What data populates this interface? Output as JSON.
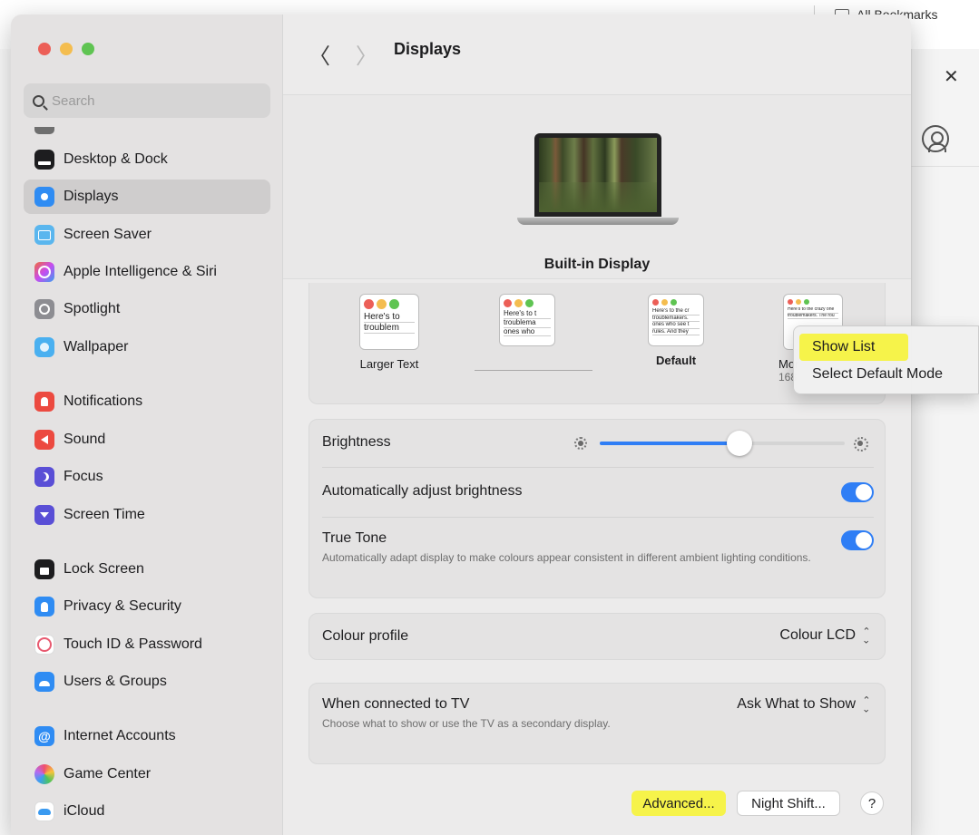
{
  "browser": {
    "bookmarks_label": "All Bookmarks",
    "close_glyph": "✕"
  },
  "sidebar": {
    "search_placeholder": "Search",
    "items": [
      {
        "label": "Desktop & Dock",
        "icon": "dock-icon"
      },
      {
        "label": "Displays",
        "icon": "displays-icon",
        "selected": true
      },
      {
        "label": "Screen Saver",
        "icon": "screen-saver-icon"
      },
      {
        "label": "Apple Intelligence & Siri",
        "icon": "siri-icon"
      },
      {
        "label": "Spotlight",
        "icon": "spotlight-icon"
      },
      {
        "label": "Wallpaper",
        "icon": "wallpaper-icon"
      },
      {
        "label": "Notifications",
        "icon": "notifications-icon"
      },
      {
        "label": "Sound",
        "icon": "sound-icon"
      },
      {
        "label": "Focus",
        "icon": "focus-icon"
      },
      {
        "label": "Screen Time",
        "icon": "screen-time-icon"
      },
      {
        "label": "Lock Screen",
        "icon": "lock-screen-icon"
      },
      {
        "label": "Privacy & Security",
        "icon": "privacy-icon"
      },
      {
        "label": "Touch ID & Password",
        "icon": "touch-id-icon"
      },
      {
        "label": "Users & Groups",
        "icon": "users-icon"
      },
      {
        "label": "Internet Accounts",
        "icon": "internet-accounts-icon"
      },
      {
        "label": "Game Center",
        "icon": "game-center-icon"
      },
      {
        "label": "iCloud",
        "icon": "icloud-icon"
      }
    ]
  },
  "header": {
    "back_glyph": "〈",
    "forward_glyph": "〉",
    "title": "Displays"
  },
  "display": {
    "name": "Built-in Display"
  },
  "resolutions": [
    {
      "label": "Larger Text",
      "preview": "Here's to",
      "preview2": "troublem",
      "bold": false
    },
    {
      "label": "",
      "preview": "Here's to t",
      "preview2": "troublema",
      "preview3": "ones who",
      "bold": false
    },
    {
      "label": "Default",
      "preview": "Here's to the cr",
      "preview2": "troublemakers.",
      "preview3": "ones who see t",
      "preview4": "rules. And they",
      "bold": true
    },
    {
      "label": "Mor",
      "sublabel": "168",
      "preview": "Here's to the crazy one",
      "preview2": "troublemakers. The rou",
      "bold": false
    }
  ],
  "brightness": {
    "label": "Brightness",
    "level_percent": 57
  },
  "settings": {
    "auto_brightness_label": "Automatically adjust brightness",
    "auto_brightness_on": true,
    "true_tone_label": "True Tone",
    "true_tone_desc": "Automatically adapt display to make colours appear consistent in different ambient lighting conditions.",
    "true_tone_on": true,
    "colour_profile_label": "Colour profile",
    "colour_profile_value": "Colour LCD",
    "tv_label": "When connected to TV",
    "tv_desc": "Choose what to show or use the TV as a secondary display.",
    "tv_value": "Ask What to Show"
  },
  "buttons": {
    "advanced": "Advanced...",
    "night_shift": "Night Shift...",
    "help": "?"
  },
  "context_menu": {
    "items": [
      "Show List",
      "Select Default Mode"
    ]
  },
  "colors": {
    "accent": "#2f7ef5",
    "highlight": "#f6f34a"
  }
}
